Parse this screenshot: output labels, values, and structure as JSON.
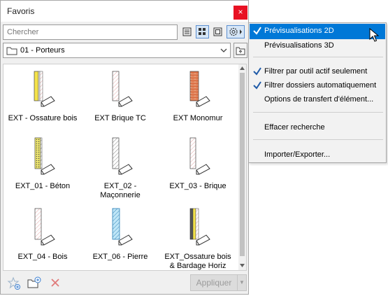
{
  "window": {
    "title": "Favoris",
    "close": "×"
  },
  "search": {
    "placeholder": "Chercher"
  },
  "folder": {
    "name": "01 - Porteurs"
  },
  "items": [
    {
      "label": "EXT - Ossature bois"
    },
    {
      "label": "EXT Brique TC"
    },
    {
      "label": "EXT Monomur"
    },
    {
      "label": "EXT_01 - Béton"
    },
    {
      "label": "EXT_02 -\nMaçonnerie"
    },
    {
      "label": "EXT_03 - Brique"
    },
    {
      "label": "EXT_04 - Bois"
    },
    {
      "label": "EXT_06 - Pierre"
    },
    {
      "label": "EXT_Ossature bois\n& Bardage Horiz"
    }
  ],
  "footer": {
    "apply": "Appliquer",
    "arrow": "▼"
  },
  "menu": {
    "items": [
      {
        "label": "Prévisualisations 2D",
        "checked": true,
        "highlighted": true
      },
      {
        "label": "Prévisualisations 3D",
        "checked": false
      },
      {
        "label": "Filtrer par outil actif seulement",
        "checked": true
      },
      {
        "label": "Filtrer dossiers automatiquement",
        "checked": true
      },
      {
        "label": "Options de transfert d'élément...",
        "checked": false
      },
      {
        "label": "Effacer recherche",
        "checked": false
      },
      {
        "label": "Importer/Exporter...",
        "checked": false
      }
    ]
  },
  "colors": {
    "accent": "#0078d7",
    "close": "#e81123",
    "check": "#1e5aa8",
    "wood": "#f4e34a",
    "brick": "#d9663a",
    "glass": "#8fd3f0"
  }
}
